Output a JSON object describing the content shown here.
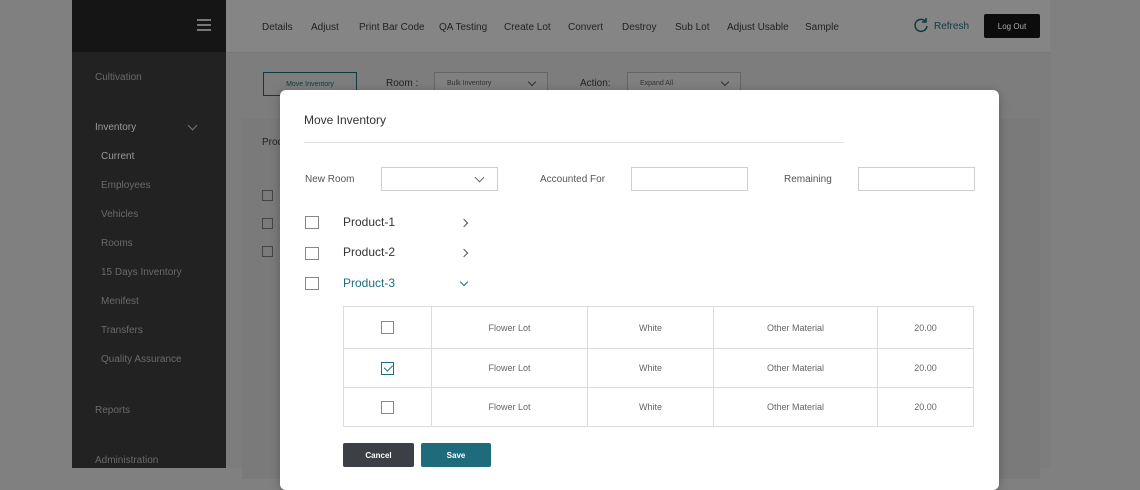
{
  "sidebar": {
    "items": [
      {
        "label": "Cultivation"
      },
      {
        "label": "Inventory"
      },
      {
        "label": "Current"
      },
      {
        "label": "Employees"
      },
      {
        "label": "Vehicles"
      },
      {
        "label": "Rooms"
      },
      {
        "label": "15 Days Inventory"
      },
      {
        "label": "Menifest"
      },
      {
        "label": "Transfers"
      },
      {
        "label": "Quality Assurance"
      },
      {
        "label": "Reports"
      },
      {
        "label": "Administration"
      }
    ]
  },
  "topnav": {
    "items": [
      "Details",
      "Adjust",
      "Print Bar Code",
      "QA Testing",
      "Create Lot",
      "Convert",
      "Destroy",
      "Sub Lot",
      "Adjust Usable",
      "Sample"
    ],
    "refresh_label": "Refresh",
    "logout_label": "Log Out"
  },
  "background": {
    "move_button": "Move Inventory",
    "room_label": "Room :",
    "room_value": "Bulk Inventory",
    "action_label": "Action:",
    "action_value": "Expand All",
    "panel_title": "Proc"
  },
  "modal": {
    "title": "Move Inventory",
    "new_room_label": "New Room",
    "new_room_value": "",
    "accounted_label": "Accounted For",
    "accounted_value": "",
    "remaining_label": "Remaining",
    "remaining_value": "",
    "products": [
      {
        "label": "Product-1",
        "expanded": false
      },
      {
        "label": "Product-2",
        "expanded": false
      },
      {
        "label": "Product-3",
        "expanded": true
      }
    ],
    "rows": [
      {
        "checked": false,
        "lot": "Flower Lot",
        "color": "White",
        "material": "Other Material",
        "qty": "20.00"
      },
      {
        "checked": true,
        "lot": "Flower Lot",
        "color": "White",
        "material": "Other Material",
        "qty": "20.00"
      },
      {
        "checked": false,
        "lot": "Flower Lot",
        "color": "White",
        "material": "Other Material",
        "qty": "20.00"
      }
    ],
    "cancel_label": "Cancel",
    "save_label": "Save"
  },
  "colors": {
    "accent": "#1e6b7b",
    "overlay_gray": "#808080",
    "cancel_button": "#3c3f45"
  }
}
